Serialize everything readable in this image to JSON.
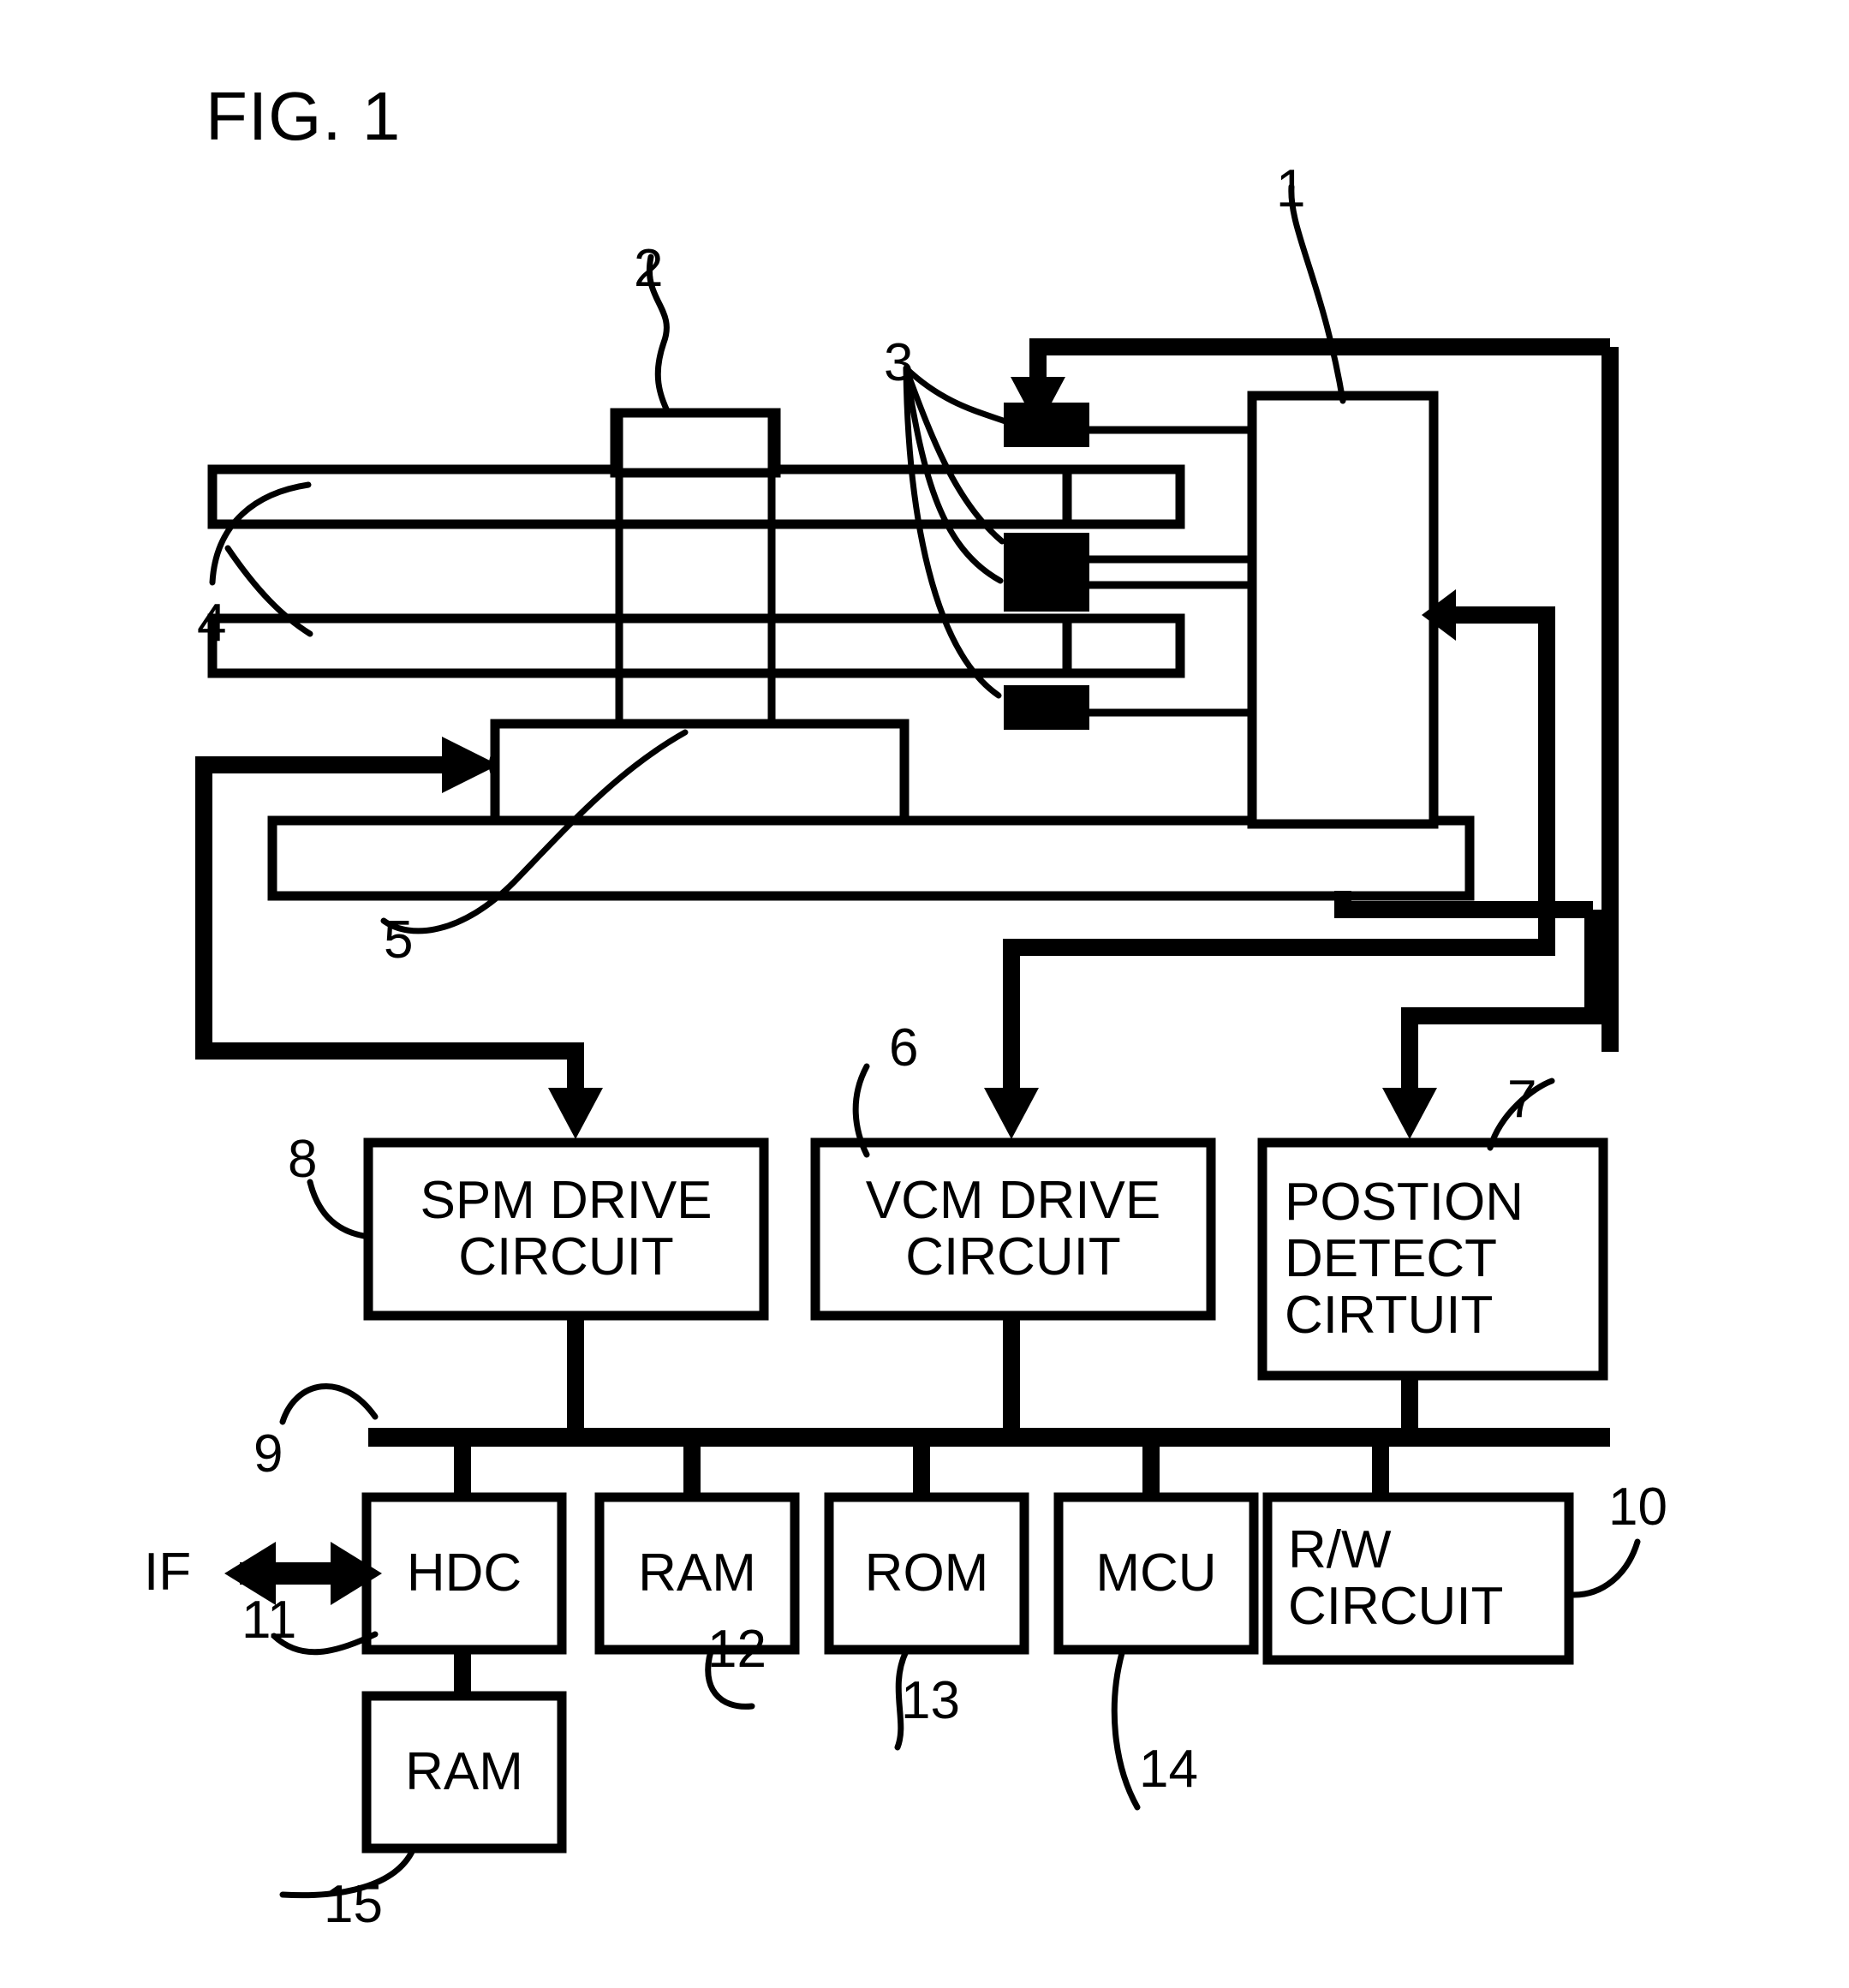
{
  "figure": {
    "title": "FIG. 1",
    "ink_color": "#000000",
    "background_color": "#ffffff"
  },
  "blocks": [
    {
      "id": "spm_drive",
      "label": "SPM DRIVE\nCIRCUIT",
      "ref": "8"
    },
    {
      "id": "vcm_drive",
      "label": "VCM DRIVE\nCIRCUIT",
      "ref": "6"
    },
    {
      "id": "position_detect",
      "label": "POSTION\nDETECT\nCIRTUIT",
      "ref": "7"
    },
    {
      "id": "hdc",
      "label": "HDC",
      "ref": "11"
    },
    {
      "id": "ram_main",
      "label": "RAM",
      "ref": "12"
    },
    {
      "id": "rom",
      "label": "ROM",
      "ref": "13"
    },
    {
      "id": "mcu",
      "label": "MCU",
      "ref": "14"
    },
    {
      "id": "rw_circuit",
      "label": "R/W\nCIRCUIT",
      "ref": "10"
    },
    {
      "id": "ram_buffer",
      "label": "RAM",
      "ref": "15"
    }
  ],
  "mechanical_refs": {
    "head_actuator": "1",
    "spindle_hub": "2",
    "heads": "3",
    "disks": "4",
    "spindle_motor": "5",
    "bus": "9"
  },
  "interface": {
    "label": "IF"
  }
}
